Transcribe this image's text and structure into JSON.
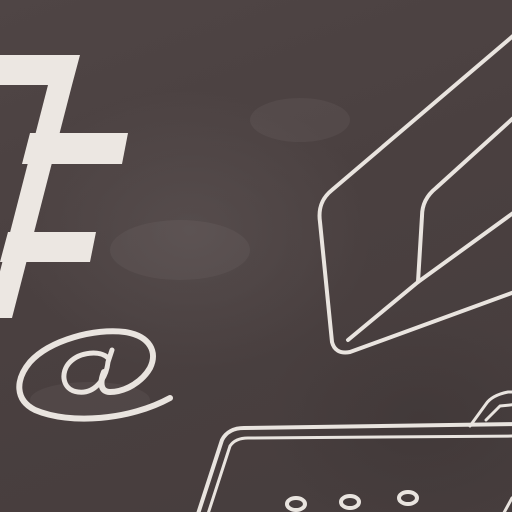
{
  "scene": {
    "description_free": true,
    "background_color": "#4a4141",
    "line_color": "#e9e4df",
    "icons": [
      "letter-f-icon",
      "at-sign-icon",
      "pencil-icon",
      "laptop-icon"
    ]
  }
}
